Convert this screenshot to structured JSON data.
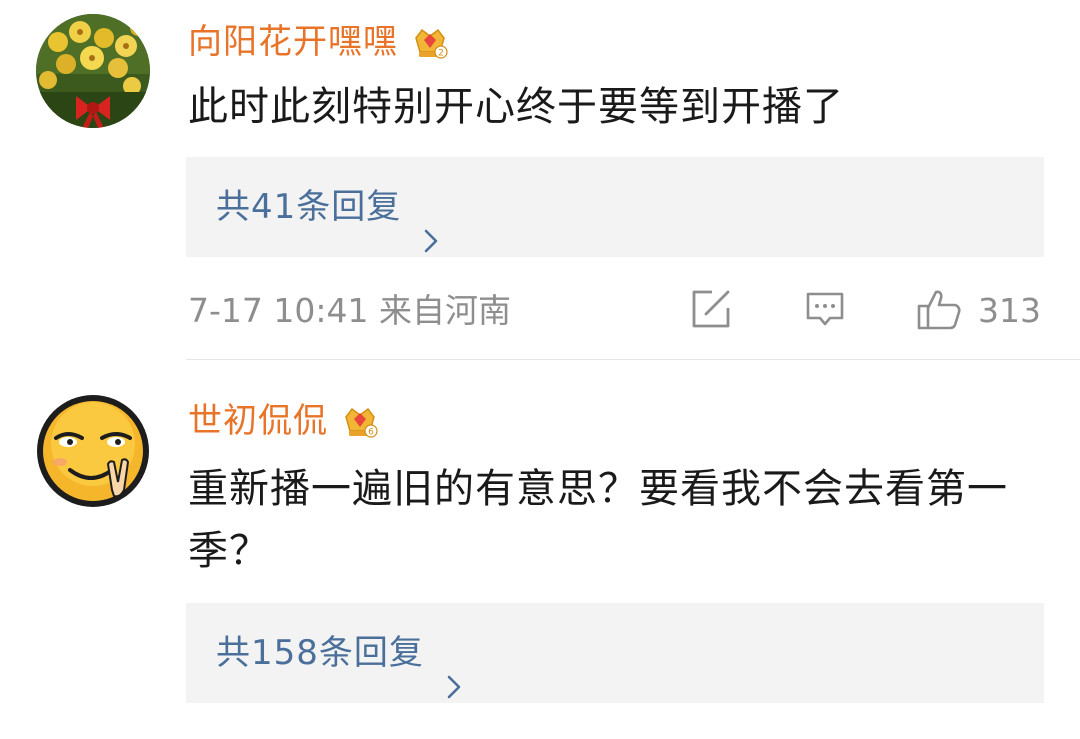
{
  "comments": [
    {
      "avatar_icon": "flower-bouquet-avatar",
      "username": "向阳花开嘿嘿",
      "badge": "crown-level-2-icon",
      "text": "此时此刻特别开心终于要等到开播了",
      "replies_label": "共41条回复",
      "time": "7-17 10:41",
      "location": "来自河南",
      "likes": "313"
    },
    {
      "avatar_icon": "smiley-peace-avatar",
      "username": "世初侃侃",
      "badge": "crown-level-6-icon",
      "text": "重新播一遍旧的有意思？要看我不会去看第一季？",
      "replies_label": "共158条回复"
    }
  ],
  "colors": {
    "username": "#e8742a",
    "reply_link": "#4a6f9a",
    "reply_bg": "#f3f3f3",
    "meta": "#8e8e8e",
    "text": "#1a1a1a"
  }
}
